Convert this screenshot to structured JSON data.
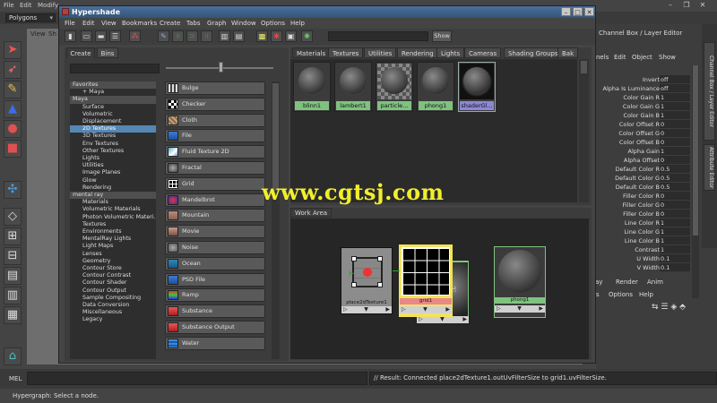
{
  "maya": {
    "menu": [
      "File",
      "Edit",
      "Modify"
    ],
    "mode_select": "Polygons",
    "viewport_menu": [
      "View",
      "Sh"
    ]
  },
  "channel_box": {
    "title": "Channel Box / Layer Editor",
    "menu": [
      "nels",
      "Edit",
      "Object",
      "Show"
    ],
    "attributes": [
      {
        "label": "Invert",
        "value": "off"
      },
      {
        "label": "Alpha Is Luminance",
        "value": "off"
      },
      {
        "label": "Color Gain R",
        "value": "1"
      },
      {
        "label": "Color Gain G",
        "value": "1"
      },
      {
        "label": "Color Gain B",
        "value": "1"
      },
      {
        "label": "Color Offset R",
        "value": "0"
      },
      {
        "label": "Color Offset G",
        "value": "0"
      },
      {
        "label": "Color Offset B",
        "value": "0"
      },
      {
        "label": "Alpha Gain",
        "value": "1"
      },
      {
        "label": "Alpha Offset",
        "value": "0"
      },
      {
        "label": "Default Color R",
        "value": "0.5"
      },
      {
        "label": "Default Color G",
        "value": "0.5"
      },
      {
        "label": "Default Color B",
        "value": "0.5"
      },
      {
        "label": "Filler Color R",
        "value": "0"
      },
      {
        "label": "Filler Color G",
        "value": "0"
      },
      {
        "label": "Filler Color B",
        "value": "0"
      },
      {
        "label": "Line Color R",
        "value": "1"
      },
      {
        "label": "Line Color G",
        "value": "1"
      },
      {
        "label": "Line Color B",
        "value": "1"
      },
      {
        "label": "Contrast",
        "value": "1"
      },
      {
        "label": "U Width",
        "value": "0.1"
      },
      {
        "label": "V Width",
        "value": "0.1"
      }
    ],
    "side_tabs": [
      "Channel Box / Layer Editor",
      "Attribute Editor"
    ],
    "layer_tabs": [
      "lay",
      "Render",
      "Anim"
    ],
    "layer_menu": [
      "rs",
      "Options",
      "Help"
    ]
  },
  "hypershade": {
    "title": "Hypershade",
    "menu": [
      "File",
      "Edit",
      "View",
      "Bookmarks",
      "Create",
      "Tabs",
      "Graph",
      "Window",
      "Options",
      "Help"
    ],
    "show_button": "Show",
    "create_tabs": [
      "Create",
      "Bins"
    ],
    "tree": [
      {
        "label": "Favorites",
        "kind": "cat"
      },
      {
        "label": "+ Maya",
        "kind": "sub"
      },
      {
        "label": "Maya",
        "kind": "cat"
      },
      {
        "label": "Surface",
        "kind": "sub"
      },
      {
        "label": "Volumetric",
        "kind": "sub"
      },
      {
        "label": "Displacement",
        "kind": "sub"
      },
      {
        "label": "2D Textures",
        "kind": "sub sel"
      },
      {
        "label": "3D Textures",
        "kind": "sub"
      },
      {
        "label": "Env Textures",
        "kind": "sub"
      },
      {
        "label": "Other Textures",
        "kind": "sub"
      },
      {
        "label": "Lights",
        "kind": "sub"
      },
      {
        "label": "Utilities",
        "kind": "sub"
      },
      {
        "label": "Image Planes",
        "kind": "sub"
      },
      {
        "label": "Glow",
        "kind": "sub"
      },
      {
        "label": "Rendering",
        "kind": "sub"
      },
      {
        "label": "mental ray",
        "kind": "cat"
      },
      {
        "label": "Materials",
        "kind": "sub"
      },
      {
        "label": "Volumetric Materials",
        "kind": "sub"
      },
      {
        "label": "Photon Volumetric Materi...",
        "kind": "sub"
      },
      {
        "label": "Textures",
        "kind": "sub"
      },
      {
        "label": "Environments",
        "kind": "sub"
      },
      {
        "label": "MentalRay Lights",
        "kind": "sub"
      },
      {
        "label": "Light Maps",
        "kind": "sub"
      },
      {
        "label": "Lenses",
        "kind": "sub"
      },
      {
        "label": "Geometry",
        "kind": "sub"
      },
      {
        "label": "Contour Store",
        "kind": "sub"
      },
      {
        "label": "Contour Contrast",
        "kind": "sub"
      },
      {
        "label": "Contour Shader",
        "kind": "sub"
      },
      {
        "label": "Contour Output",
        "kind": "sub"
      },
      {
        "label": "Sample Compositing",
        "kind": "sub"
      },
      {
        "label": "Data Conversion",
        "kind": "sub"
      },
      {
        "label": "Miscellaneous",
        "kind": "sub"
      },
      {
        "label": "Legacy",
        "kind": "sub"
      }
    ],
    "textures": [
      {
        "label": "Bulge",
        "icon": "bulge-icon"
      },
      {
        "label": "Checker",
        "icon": "checker-icon"
      },
      {
        "label": "Cloth",
        "icon": "cloth-icon"
      },
      {
        "label": "File",
        "icon": "file-icon"
      },
      {
        "label": "Fluid Texture 2D",
        "icon": "fluid-texture-icon"
      },
      {
        "label": "Fractal",
        "icon": "fractal-icon"
      },
      {
        "label": "Grid",
        "icon": "grid-icon"
      },
      {
        "label": "Mandelbrot",
        "icon": "mandelbrot-icon"
      },
      {
        "label": "Mountain",
        "icon": "mountain-icon"
      },
      {
        "label": "Movie",
        "icon": "movie-icon"
      },
      {
        "label": "Noise",
        "icon": "noise-icon"
      },
      {
        "label": "Ocean",
        "icon": "ocean-icon"
      },
      {
        "label": "PSD File",
        "icon": "psd-file-icon"
      },
      {
        "label": "Ramp",
        "icon": "ramp-icon"
      },
      {
        "label": "Substance",
        "icon": "substance-icon"
      },
      {
        "label": "Substance Output",
        "icon": "substance-output-icon"
      },
      {
        "label": "Water",
        "icon": "water-icon"
      }
    ],
    "mat_tabs": [
      "Materials",
      "Textures",
      "Utilities",
      "Rendering",
      "Lights",
      "Cameras",
      "Shading Groups",
      "Bak"
    ],
    "swatches": [
      "blinn1",
      "lambert1",
      "particle...",
      "phong1",
      "shaderGl..."
    ],
    "work_area_tab": "Work Area",
    "nodes": {
      "place2d": "place2dTexture1",
      "grid": "grid1",
      "phong": "phong1"
    }
  },
  "bottom": {
    "mel_label": "MEL",
    "result": "// Result: Connected place2dTexture1.outUvFilterSize to grid1.uvFilterSize.",
    "help": "Hypergraph: Select a node."
  },
  "watermark": "www.cgtsj.com",
  "colors": {
    "node_green": "#7fc27f",
    "node_red": "#e98888",
    "node_yellow": "#f2e35a",
    "selection_blue": "#5587b5",
    "watermark": "#f2ef2b"
  }
}
